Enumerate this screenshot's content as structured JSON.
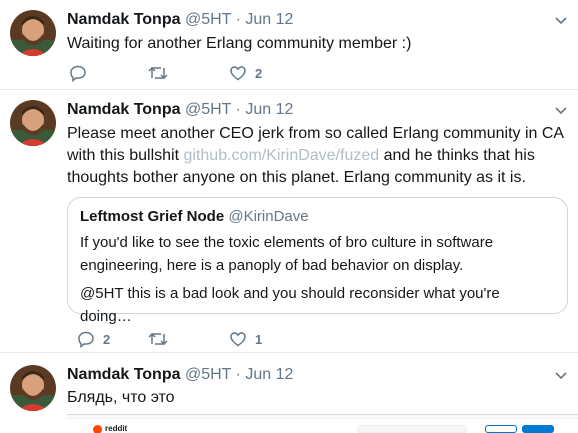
{
  "tweets": [
    {
      "name": "Namdak Tonpa",
      "handle": "@5HT",
      "separator": "·",
      "date": "Jun 12",
      "text": "Waiting for another Erlang community member :)",
      "replies": "",
      "retweets": "",
      "likes": "2"
    },
    {
      "name": "Namdak Tonpa",
      "handle": "@5HT",
      "separator": "·",
      "date": "Jun 12",
      "text_before": "Please meet another CEO jerk from so called Erlang community in CA with this bullshit ",
      "link": "github.com/KirinDave/fuzed",
      "text_after": " and he thinks that his thoughts bother anyone on this planet. Erlang community as it is.",
      "quote": {
        "name": "Leftmost Grief Node",
        "handle": "@KirinDave",
        "text1": "If you'd like to see the toxic elements of bro culture in software engineering, here is a panoply of bad behavior on display.",
        "text2": "@5HT this is a bad look and you should reconsider what you're doing…"
      },
      "replies": "2",
      "retweets": "",
      "likes": "1"
    },
    {
      "name": "Namdak Tonpa",
      "handle": "@5HT",
      "separator": "·",
      "date": "Jun 12",
      "text": "Блядь, что это",
      "embed": {
        "brand": "reddit"
      }
    }
  ],
  "colors": {
    "text": "#14171a",
    "muted": "#657786",
    "link": "#b0bec8",
    "border": "#e6ecf0",
    "reddit": "#ff4500"
  },
  "icons": [
    "reply-icon",
    "retweet-icon",
    "like-icon",
    "chevron-down-icon"
  ]
}
